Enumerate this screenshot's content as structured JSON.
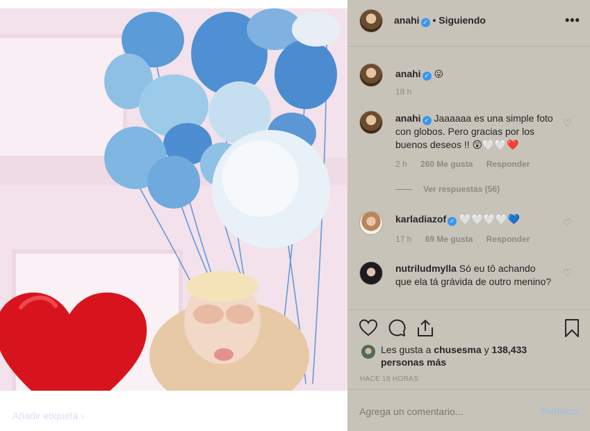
{
  "photo": {
    "caption": "Añadir etiqueta ›"
  },
  "header": {
    "username": "anahi",
    "separator": "•",
    "follow_status": "Siguiendo",
    "more": "•••"
  },
  "comments": [
    {
      "username": "anahi",
      "text": "😛",
      "time": "18 h"
    },
    {
      "username": "anahi",
      "text": "Jaaaaaa es una simple foto con globos. Pero gracias por los buenos deseos !! 😲🤍🤍❤️",
      "time": "2 h",
      "likes": "260 Me gusta",
      "reply": "Responder",
      "view_replies": "Ver respuestas (56)"
    },
    {
      "username": "karladiazof",
      "text": "🤍🤍🤍🤍💙",
      "time": "17 h",
      "likes": "69 Me gusta",
      "reply": "Responder"
    },
    {
      "username": "nutriludmylla",
      "text": "Só eu tô achando que ela tá grávida de outro menino?"
    }
  ],
  "likes": {
    "prefix": "Les gusta a",
    "user": "chusesma",
    "connector": "y",
    "count": "138,433 personas más"
  },
  "time_ago": "HACE 18 HORAS",
  "add_comment": {
    "placeholder": "Agrega un comentario...",
    "publish": "Publicar"
  }
}
